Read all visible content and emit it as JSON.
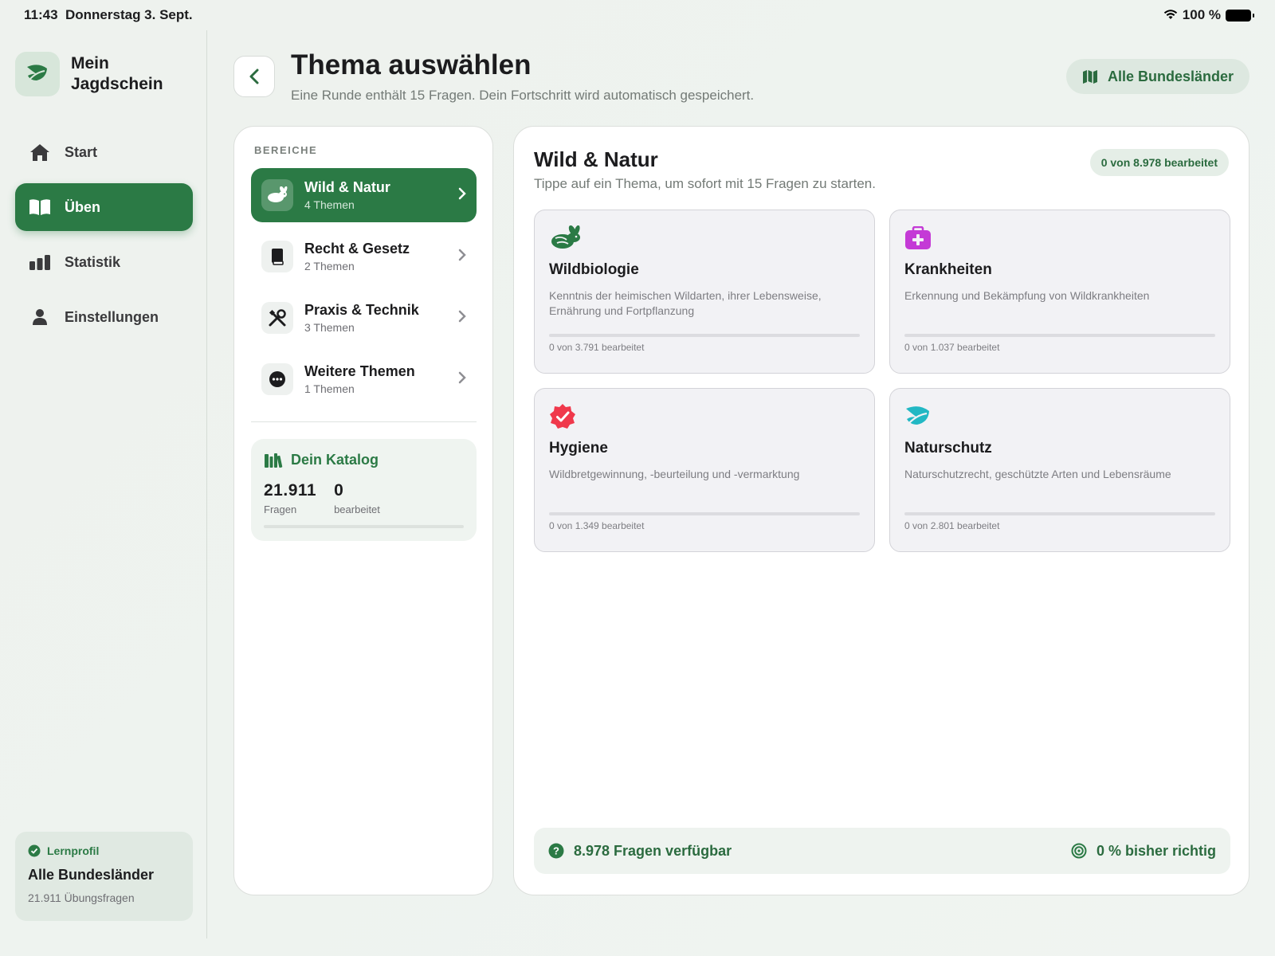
{
  "status_bar": {
    "time": "11:43",
    "date": "Donnerstag 3. Sept.",
    "battery": "100 %"
  },
  "brand": {
    "name": "Mein Jagdschein"
  },
  "nav": {
    "items": [
      {
        "label": "Start",
        "icon": "house-icon"
      },
      {
        "label": "Üben",
        "icon": "book-icon",
        "active": true
      },
      {
        "label": "Statistik",
        "icon": "chart-icon"
      },
      {
        "label": "Einstellungen",
        "icon": "person-icon"
      }
    ]
  },
  "profile": {
    "tag": "Lernprofil",
    "name": "Alle Bundesländer",
    "count": "21.911 Übungsfragen"
  },
  "header": {
    "title": "Thema auswählen",
    "subtitle": "Eine Runde enthält 15 Fragen. Dein Fortschritt wird automatisch gespeichert.",
    "region_button": "Alle Bundesländer"
  },
  "sidebar_panel": {
    "heading": "BEREICHE",
    "categories": [
      {
        "name": "Wild & Natur",
        "sub": "4 Themen",
        "icon": "rabbit-icon",
        "active": true
      },
      {
        "name": "Recht & Gesetz",
        "sub": "2 Themen",
        "icon": "law-book-icon"
      },
      {
        "name": "Praxis & Technik",
        "sub": "3 Themen",
        "icon": "tools-icon"
      },
      {
        "name": "Weitere Themen",
        "sub": "1 Themen",
        "icon": "more-icon"
      }
    ],
    "catalog": {
      "title": "Dein Katalog",
      "questions": "21.911",
      "questions_label": "Fragen",
      "done": "0",
      "done_label": "bearbeitet",
      "progress": 0
    }
  },
  "main": {
    "title": "Wild & Natur",
    "subtitle": "Tippe auf ein Thema, um sofort mit 15 Fragen zu starten.",
    "badge": "0 von 8.978 bearbeitet",
    "topics": [
      {
        "name": "Wildbiologie",
        "desc": "Kenntnis der heimischen Wildarten, ihrer Lebensweise, Ernährung und Fortpflanzung",
        "progress_text": "0 von 3.791 bearbeitet",
        "progress": 0,
        "icon": "rabbit-icon",
        "color": "#2b7a45"
      },
      {
        "name": "Krankheiten",
        "desc": "Erkennung und Bekämpfung von Wildkrankheiten",
        "progress_text": "0 von 1.037 bearbeitet",
        "progress": 0,
        "icon": "medkit-icon",
        "color": "#c43ad6"
      },
      {
        "name": "Hygiene",
        "desc": "Wildbretgewinnung, -beurteilung und -vermarktung",
        "progress_text": "0 von 1.349 bearbeitet",
        "progress": 0,
        "icon": "checkmark-seal-icon",
        "color": "#f0384b"
      },
      {
        "name": "Naturschutz",
        "desc": "Naturschutzrecht, geschützte Arten und Lebensräume",
        "progress_text": "0 von 2.801 bearbeitet",
        "progress": 0,
        "icon": "leaf-icon",
        "color": "#22b8c4"
      }
    ],
    "footer": {
      "available": "8.978 Fragen verfügbar",
      "correct": "0 % bisher richtig"
    }
  },
  "colors": {
    "accent": "#2b7a45",
    "accent_light": "#e5eee7"
  }
}
